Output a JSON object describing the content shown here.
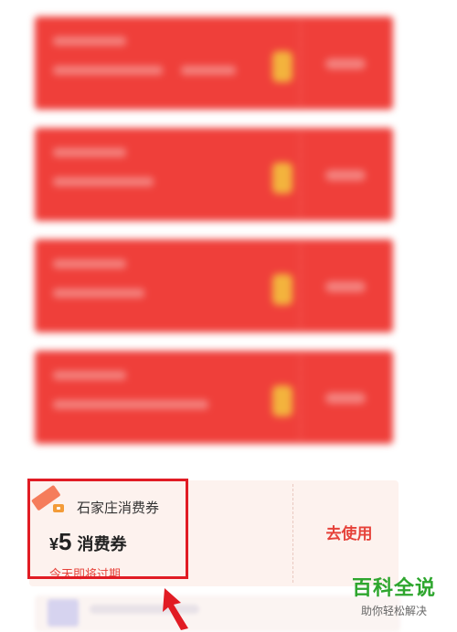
{
  "coupon": {
    "store_name": "石家庄消费券",
    "currency": "¥",
    "amount": "5",
    "type_label": "消费券",
    "expire_text": "今天即将过期",
    "use_button": "去使用"
  },
  "watermark": {
    "title": "百科全说",
    "subtitle": "助你轻松解决"
  },
  "colors": {
    "card_red": "#ef3f3a",
    "accent_red": "#e6423a",
    "highlight_red": "#e11c24",
    "watermark_green": "#2ea62e"
  }
}
